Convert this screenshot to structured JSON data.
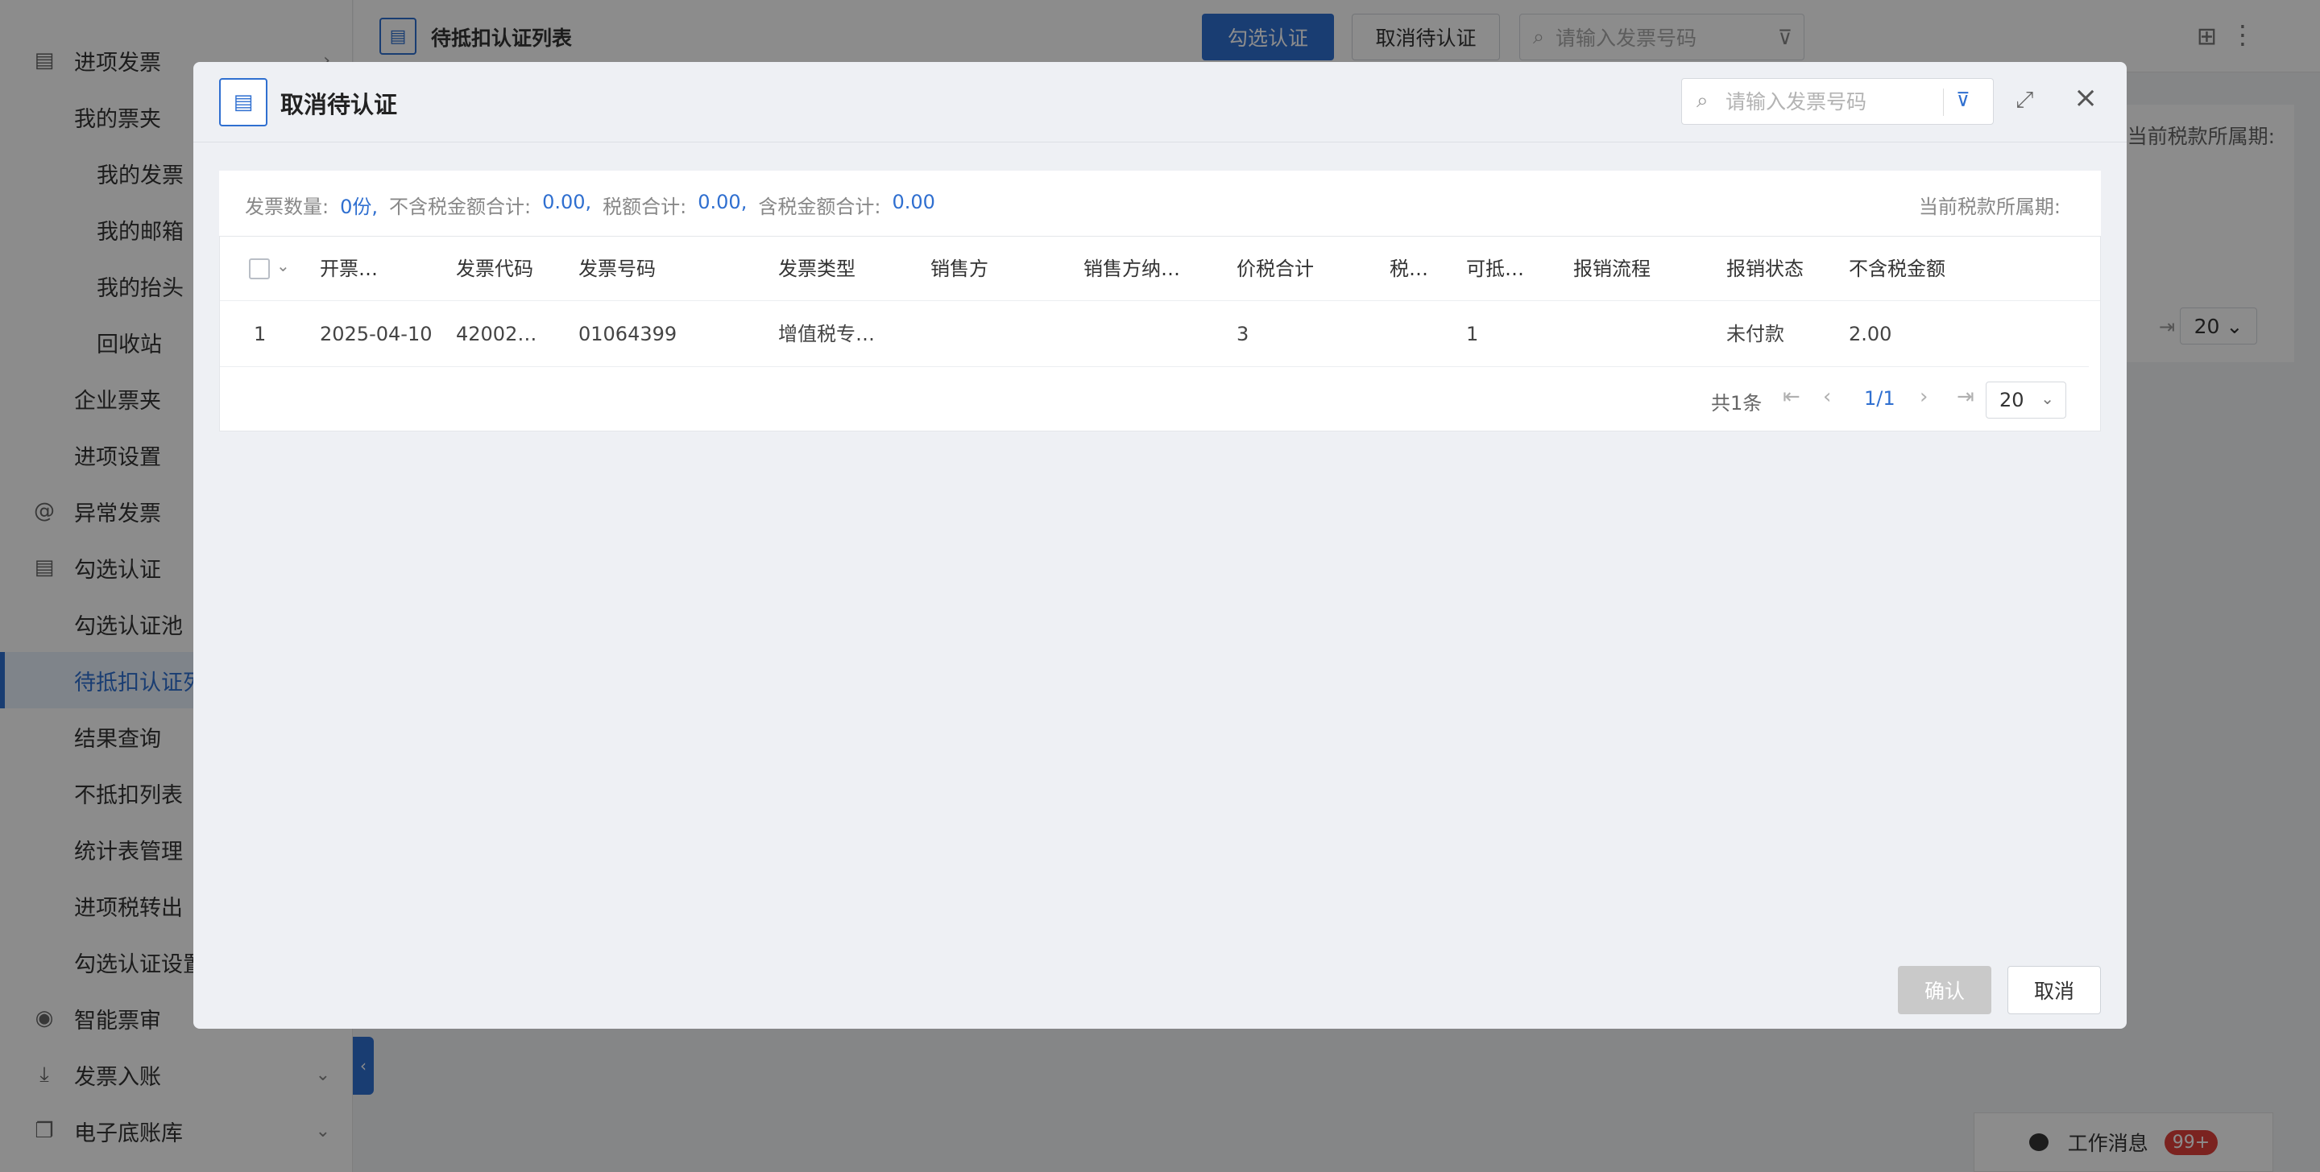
{
  "sidebar": {
    "items": [
      {
        "label": "进项发票",
        "icon": "invoice-icon",
        "chevron": "›"
      },
      {
        "label": "我的票夹"
      },
      {
        "label": "我的发票"
      },
      {
        "label": "我的邮箱"
      },
      {
        "label": "我的抬头"
      },
      {
        "label": "回收站"
      },
      {
        "label": "企业票夹"
      },
      {
        "label": "进项设置"
      },
      {
        "label": "异常发票",
        "icon": "at-icon"
      },
      {
        "label": "勾选认证",
        "icon": "document-icon"
      },
      {
        "label": "勾选认证池"
      },
      {
        "label": "待抵扣认证列表"
      },
      {
        "label": "结果查询"
      },
      {
        "label": "不抵扣列表"
      },
      {
        "label": "统计表管理"
      },
      {
        "label": "进项税转出"
      },
      {
        "label": "勾选认证设置"
      },
      {
        "label": "智能票审",
        "icon": "person-icon"
      },
      {
        "label": "发票入账",
        "icon": "download-icon",
        "chevron": "⌄"
      },
      {
        "label": "电子底账库",
        "icon": "copy-icon",
        "chevron": "⌄"
      }
    ],
    "collapse_glyph": "‹"
  },
  "page": {
    "title": "待抵扣认证列表",
    "select_btn": "勾选认证",
    "cancel_pending_btn": "取消待认证",
    "search_placeholder": "请输入发票号码",
    "period_label": "当前税款所属期:",
    "page_size": "20",
    "messages_label": "工作消息",
    "messages_badge": "99+"
  },
  "modal": {
    "title": "取消待认证",
    "search_placeholder": "请输入发票号码",
    "summary": {
      "count_label": "发票数量:",
      "count_value": "0份,",
      "excl_label": "不含税金额合计:",
      "excl_value": "0.00,",
      "tax_label": "税额合计:",
      "tax_value": "0.00,",
      "incl_label": "含税金额合计:",
      "incl_value": "0.00",
      "period_label": "当前税款所属期:"
    },
    "columns": [
      "开票…",
      "发票代码",
      "发票号码",
      "发票类型",
      "销售方",
      "销售方纳…",
      "价税合计",
      "税…",
      "可抵…",
      "报销流程",
      "报销状态",
      "不含税金额"
    ],
    "rows": [
      [
        "1",
        "2025-04-10",
        "42002…",
        "01064399",
        "增值税专…",
        "",
        "",
        "3",
        "",
        "1",
        "",
        "未付款",
        "2.00"
      ]
    ],
    "pager": {
      "total": "共1条",
      "page": "1/1",
      "size": "20"
    },
    "confirm_label": "确认",
    "cancel_label": "取消"
  }
}
